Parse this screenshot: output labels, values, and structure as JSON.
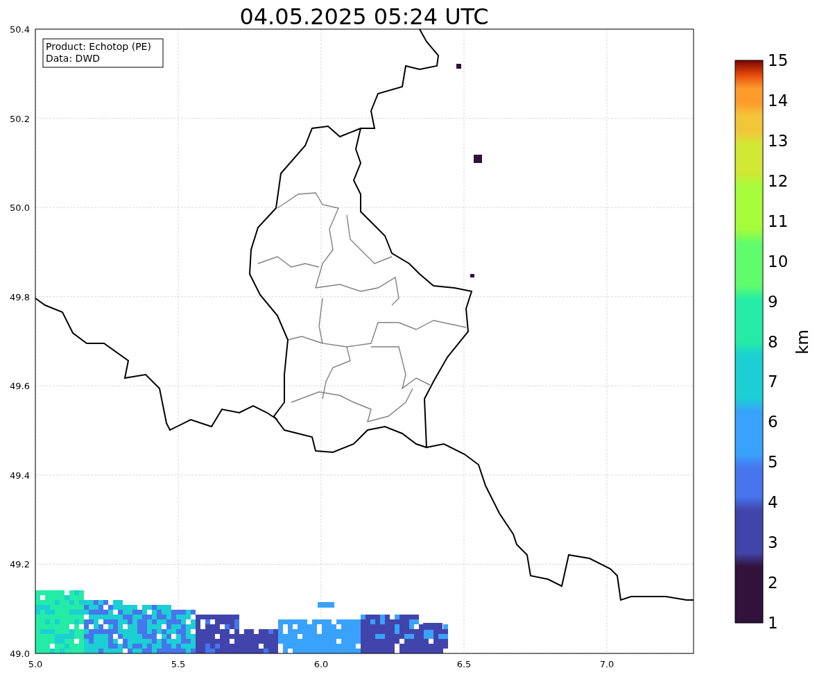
{
  "title": "04.05.2025 05:24 UTC",
  "info_box": {
    "lines": [
      "Product: Echotop (PE)",
      "Data: DWD"
    ]
  },
  "x_ticks": [
    "5.0",
    "5.5",
    "6.0",
    "6.5",
    "7.0"
  ],
  "y_ticks": [
    "50.4",
    "50.2",
    "50.0",
    "49.8",
    "49.6",
    "49.4",
    "49.2",
    "49.0"
  ],
  "colorbar": {
    "ticks": [
      "15",
      "14",
      "13",
      "12",
      "11",
      "10",
      "9",
      "8",
      "7",
      "6",
      "5",
      "4",
      "3",
      "2",
      "1"
    ],
    "label": "km"
  }
}
